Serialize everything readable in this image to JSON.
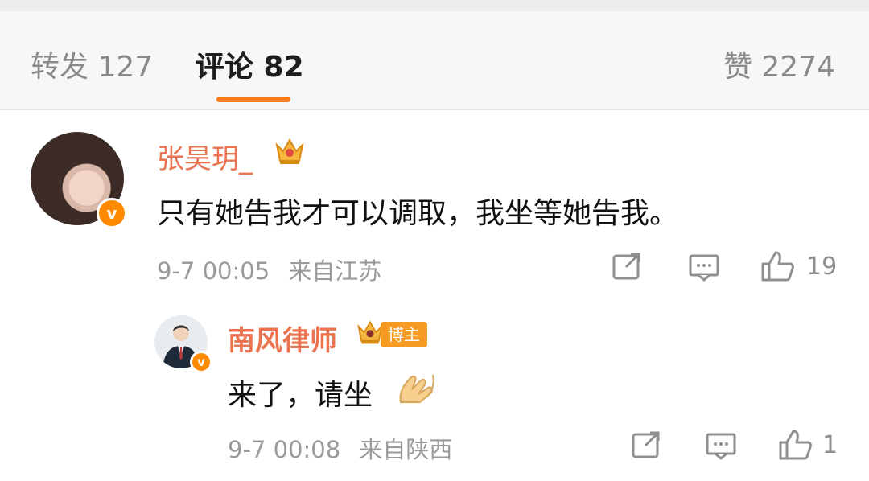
{
  "tabs": {
    "repost": "转发 127",
    "comments": "评论 82",
    "likes": "赞 2274"
  },
  "comments": [
    {
      "username": "张昊玥_",
      "text": "只有她告我才可以调取，我坐等她告我。",
      "time": "9-7 00:05",
      "location": "来自江苏",
      "likes": "19",
      "verified_mark": "v"
    },
    {
      "username": "南风律师",
      "badge": "博主",
      "text": "来了，请坐",
      "time": "9-7 00:08",
      "location": "来自陕西",
      "likes": "1",
      "verified_mark": "v"
    }
  ],
  "icons": [
    "share-icon",
    "reply-icon",
    "thumbs-up-icon",
    "crown-icon",
    "hands-emoji-icon"
  ],
  "colors": {
    "accent": "#ff7b18",
    "username": "#eb7350",
    "badge": "#f59a23",
    "meta": "#9a9a9a"
  }
}
